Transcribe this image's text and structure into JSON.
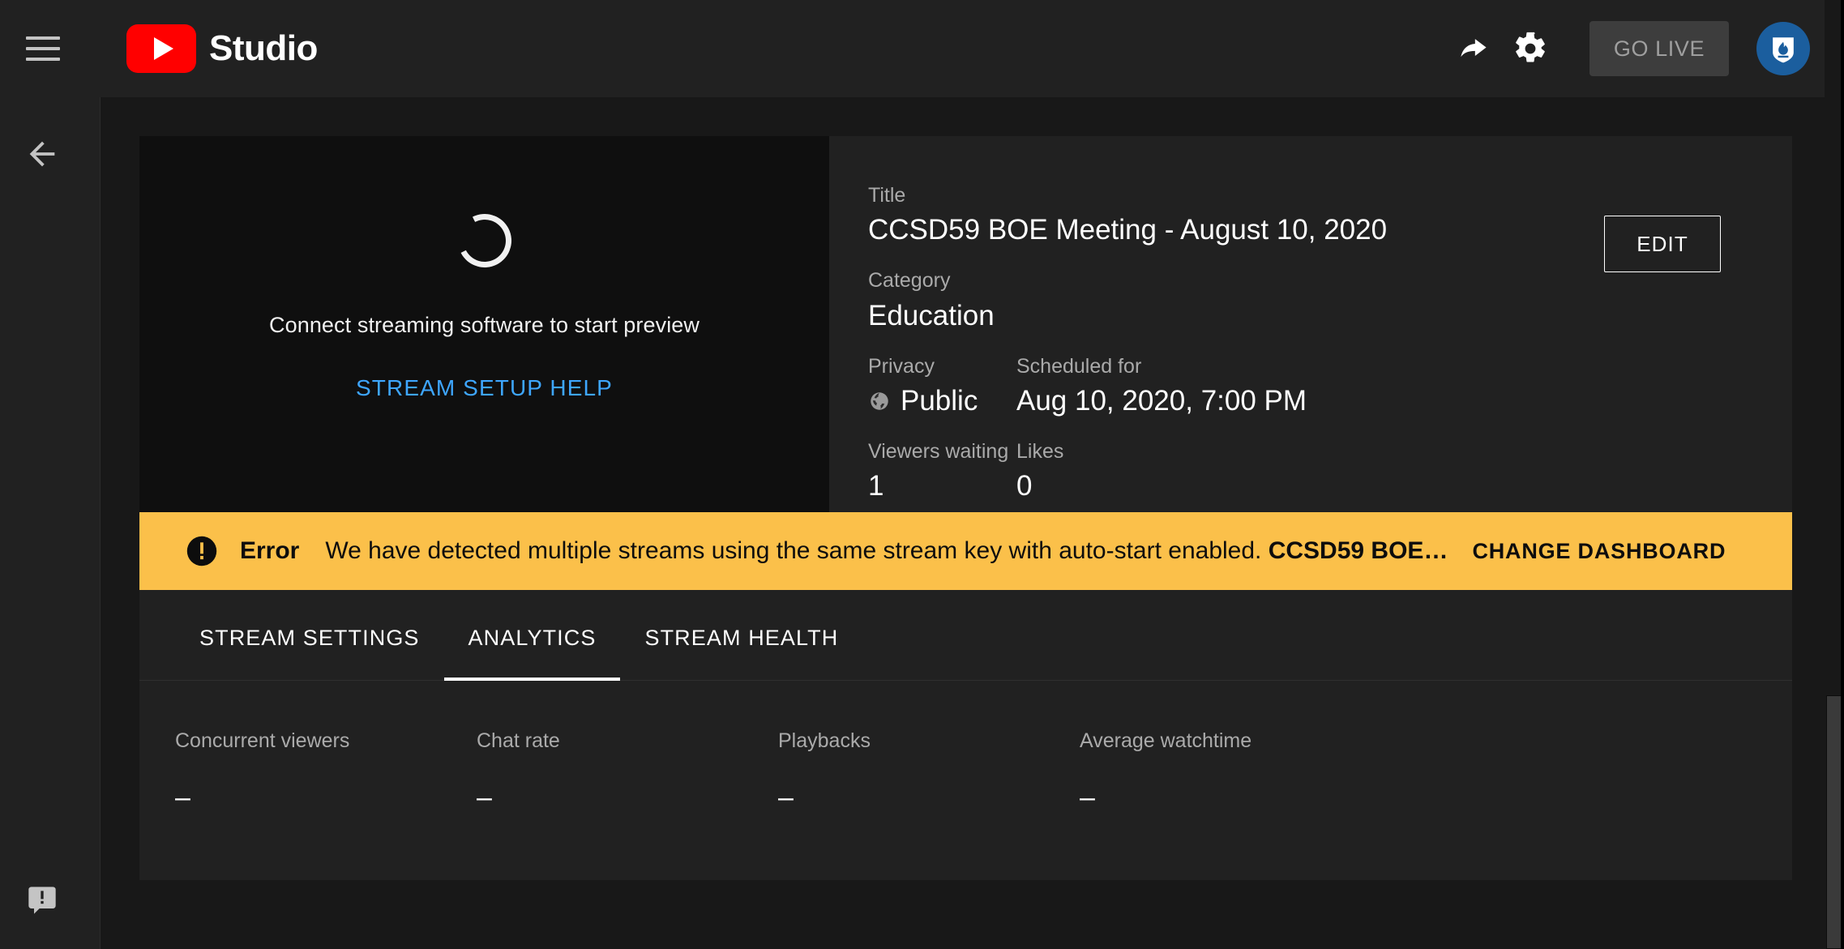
{
  "topbar": {
    "menu_icon": "hamburger-menu-icon",
    "brand_text": "Studio",
    "brand_logo_icon": "youtube-play-logo-icon",
    "share_icon": "share-arrow-icon",
    "settings_icon": "gear-icon",
    "go_live_label": "GO LIVE",
    "avatar_icon": "channel-avatar-shield-flame-icon",
    "accent_red": "#ff0000",
    "avatar_blue": "#1b5e9e",
    "go_live_bg": "#3d3d3d",
    "go_live_text_color": "#9f9f9f"
  },
  "rail": {
    "back_icon": "back-arrow-icon",
    "feedback_icon": "send-feedback-icon"
  },
  "preview": {
    "spinner_icon": "loading-spinner-icon",
    "message": "Connect streaming software to start preview",
    "help_link": "STREAM SETUP HELP",
    "link_color": "#3ea6ff"
  },
  "info": {
    "title_label": "Title",
    "title_value": "CCSD59 BOE Meeting - August 10, 2020",
    "category_label": "Category",
    "category_value": "Education",
    "privacy_label": "Privacy",
    "privacy_value": "Public",
    "privacy_icon": "globe-icon",
    "scheduled_label": "Scheduled for",
    "scheduled_value": "Aug 10, 2020, 7:00 PM",
    "viewers_label": "Viewers waiting",
    "viewers_value": "1",
    "likes_label": "Likes",
    "likes_value": "0",
    "edit_label": "EDIT"
  },
  "banner": {
    "icon": "error-exclamation-icon",
    "severity": "Error",
    "message": "We have detected multiple streams using the same stream key with auto-start enabled. ",
    "message_bold": "CCSD59 BOE…",
    "action_label": "CHANGE DASHBOARD",
    "background": "#fbc04a",
    "text_color": "#0d0d0d"
  },
  "tabs": [
    {
      "label": "STREAM SETTINGS",
      "active": false
    },
    {
      "label": "ANALYTICS",
      "active": true
    },
    {
      "label": "STREAM HEALTH",
      "active": false
    }
  ],
  "metrics": [
    {
      "label": "Concurrent viewers",
      "value": "–"
    },
    {
      "label": "Chat rate",
      "value": "–"
    },
    {
      "label": "Playbacks",
      "value": "–"
    },
    {
      "label": "Average watchtime",
      "value": "–"
    }
  ],
  "scrollbar": {
    "orientation": "vertical",
    "thumb_color": "#3a3a3a"
  }
}
